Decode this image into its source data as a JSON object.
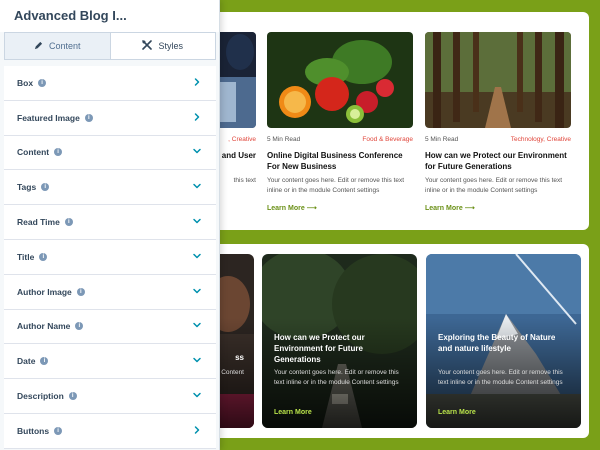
{
  "sidebar": {
    "title": "Advanced Blog I...",
    "tabs": [
      {
        "label": "Content",
        "icon": "pencil-icon"
      },
      {
        "label": "Styles",
        "icon": "tools-icon"
      }
    ],
    "items": [
      {
        "label": "Box",
        "chevron": "right"
      },
      {
        "label": "Featured Image",
        "chevron": "right"
      },
      {
        "label": "Content",
        "chevron": "down"
      },
      {
        "label": "Tags",
        "chevron": "down"
      },
      {
        "label": "Read Time",
        "chevron": "down"
      },
      {
        "label": "Title",
        "chevron": "down"
      },
      {
        "label": "Author Image",
        "chevron": "down"
      },
      {
        "label": "Author Name",
        "chevron": "down"
      },
      {
        "label": "Date",
        "chevron": "down"
      },
      {
        "label": "Description",
        "chevron": "down"
      },
      {
        "label": "Buttons",
        "chevron": "right"
      }
    ],
    "info_glyph": "i"
  },
  "preview": {
    "top_cards": [
      {
        "read_time": "",
        "tag": "Creative",
        "tag_prefix": ", ",
        "title": "and User",
        "desc": "this text",
        "link": ""
      },
      {
        "read_time": "5 Min Read",
        "tag": "Food & Beverage",
        "title": "Online Digital Business Conference For New Business",
        "desc": "Your content goes here. Edit or remove this text inline or in the module Content settings",
        "link": "Learn More"
      },
      {
        "read_time": "5 Min Read",
        "tag": "Technology, Creative",
        "title": "How can we Protect our Environment for Future Generations",
        "desc": "Your content goes here. Edit or remove this text inline or in the module Content settings",
        "link": "Learn More"
      }
    ],
    "bottom_cards": [
      {
        "title": "ss",
        "desc": "this text Content",
        "link": ""
      },
      {
        "title": "How can we Protect our Environment for Future Generations",
        "desc": "Your content goes here. Edit or remove this text inline or in the module Content settings",
        "link": "Learn More"
      },
      {
        "title": "Exploring the Beauty of Nature and nature lifestyle",
        "desc": "Your content goes here. Edit or remove this text inline or in the module Content settings",
        "link": "Learn More"
      }
    ],
    "colors": {
      "background": "#7aa018",
      "tag": "#e0453a",
      "link": "#6a9016",
      "dark_link": "#b9e34a"
    },
    "arrow_glyph": "⟶"
  }
}
